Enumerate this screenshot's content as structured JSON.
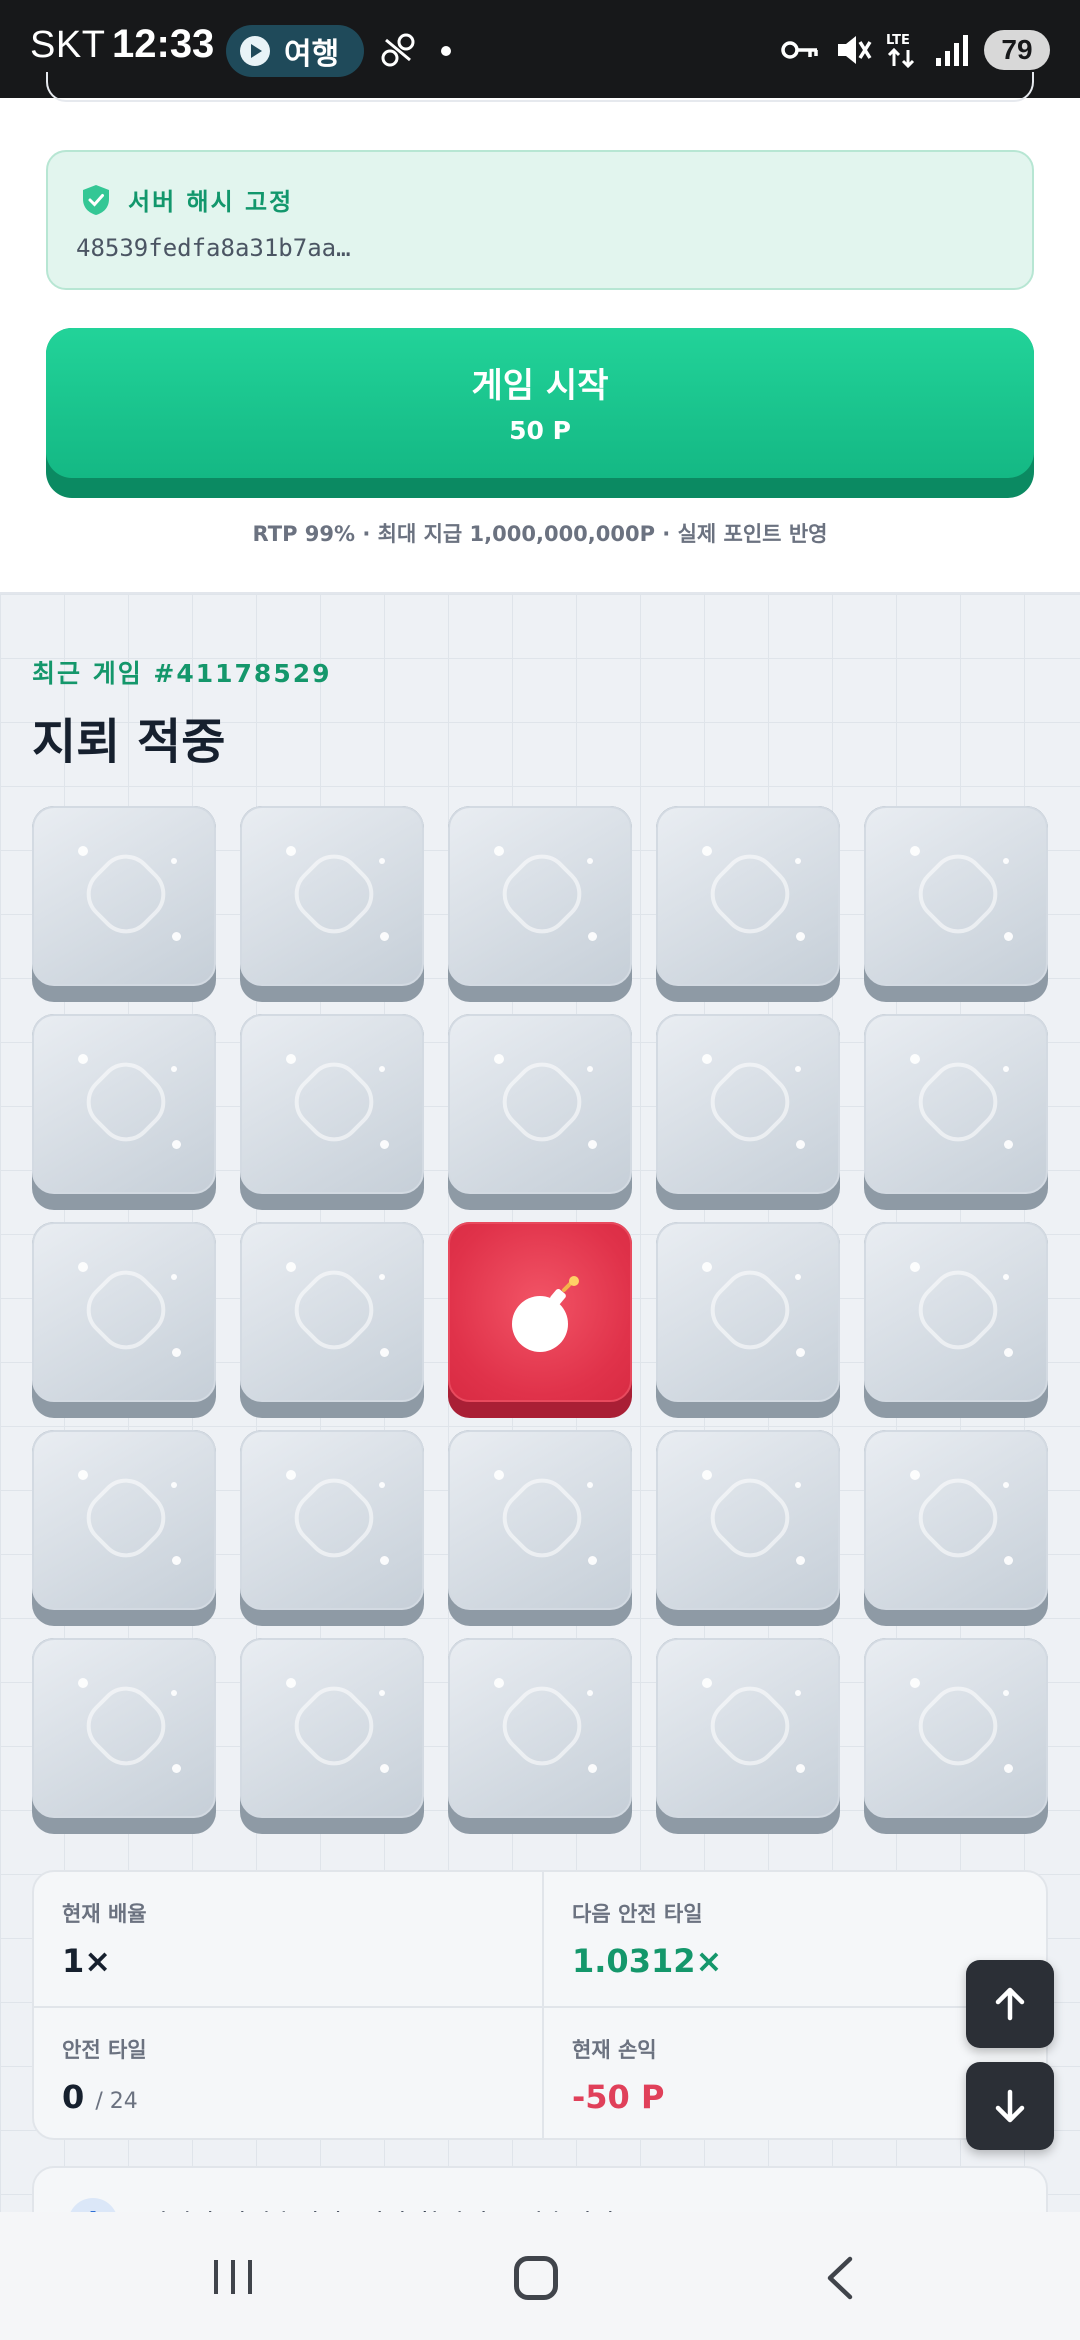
{
  "status_bar": {
    "carrier": "SKT",
    "time": "12:33",
    "pill_label": "여행",
    "battery": "79",
    "network": "LTE"
  },
  "seed": {
    "title": "서버 해시 고정",
    "hash": "48539fedfa8a31b7aa…"
  },
  "start": {
    "label": "게임 시작",
    "cost": "50 P"
  },
  "rtp_line": "RTP 99% · 최대 지급 1,000,000,000P · 실제 포인트 반영",
  "game": {
    "recent_label": "최근 게임 #41178529",
    "title": "지뢰 적중",
    "grid_size": 5,
    "mine_tile": {
      "row": 3,
      "col": 3
    }
  },
  "stats": {
    "multiplier_label": "현재 배율",
    "multiplier_value": "1×",
    "next_label": "다음 안전 타일",
    "next_value": "1.0312×",
    "safe_label": "안전 타일",
    "safe_value": "0",
    "safe_total": "/ 24",
    "profit_label": "현재 손익",
    "profit_value": "-50 P"
  },
  "info": {
    "icon": "i",
    "text": "지뢰가 나왔습니다. 결과 확인이 끝났습니다."
  },
  "colors": {
    "accent": "#14976b",
    "danger": "#e0324a",
    "button": "#1cc78f"
  }
}
